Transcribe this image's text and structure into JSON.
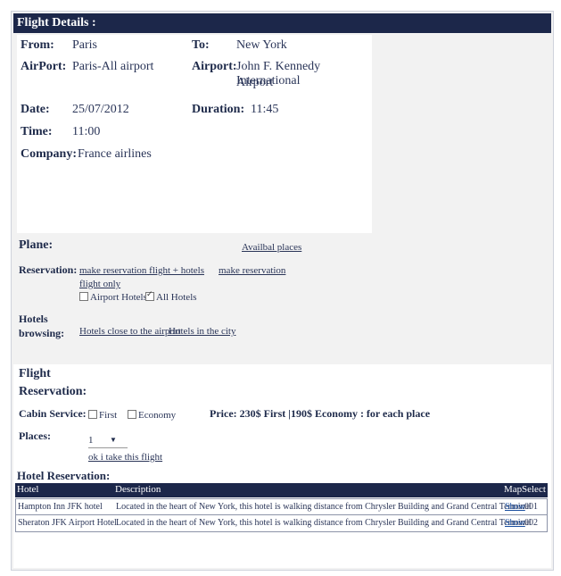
{
  "flight_details": {
    "title": "Flight Details :",
    "from_label": "From:",
    "from_value": "Paris",
    "to_label": "To:",
    "to_value": "New York",
    "airport_label_1": "AirPort:",
    "airport_value_1": "Paris-All airport",
    "airport_label_2": "Airport:",
    "airport_value_2_line1": "John F. Kennedy International",
    "airport_value_2_line2": "Airport",
    "date_label": "Date:",
    "date_value": "25/07/2012",
    "duration_label": "Duration:",
    "duration_value": "11:45",
    "time_label": "Time:",
    "time_value": "11:00",
    "company_label": "Company:",
    "company_value": "France airlines"
  },
  "plane": {
    "label": "Plane:",
    "available_places_link": "Availbal places",
    "reservation_label": "Reservation:",
    "link_flight_hotels": "make reservation flight + hotels",
    "link_make_reservation": "make reservation",
    "link_flight_only": "flight only",
    "chk_airport_hotels": "Airport Hotels",
    "chk_all_hotels": "All Hotels",
    "hotels_label_1": "Hotels",
    "hotels_label_2": "browsing:",
    "link_hotels_airport": "Hotels close to the airport",
    "link_hotels_city": "Hotels in the city"
  },
  "flight_reservation": {
    "title_1": "Flight",
    "title_2": "Reservation:",
    "cabin_label": "Cabin Service:",
    "opt_first": "First",
    "opt_economy": "Economy",
    "price_text": "Price: 230$ First |190$ Economy : for each place",
    "places_label": "Places:",
    "places_value": "1",
    "confirm_link": "ok i take this flight"
  },
  "hotel_reservation": {
    "title": "Hotel Reservation:",
    "columns": [
      "Hotel",
      "Description",
      "Map",
      "Select"
    ],
    "rows": [
      {
        "hotel": "Hampton Inn JFK hotel",
        "description": "Located in the heart of New York, this hotel is walking distance from Chrysler Building and Grand Central Terminal",
        "map": "Show",
        "select": "001"
      },
      {
        "hotel": "Sheraton JFK Airport Hotel",
        "description": "Located in the heart of New York, this hotel is walking distance from Chrysler Building and Grand Central Terminal",
        "map": "Show",
        "select": "002"
      }
    ]
  },
  "colors": {
    "header_bg": "#1c274a",
    "text": "#1e2a4a"
  }
}
